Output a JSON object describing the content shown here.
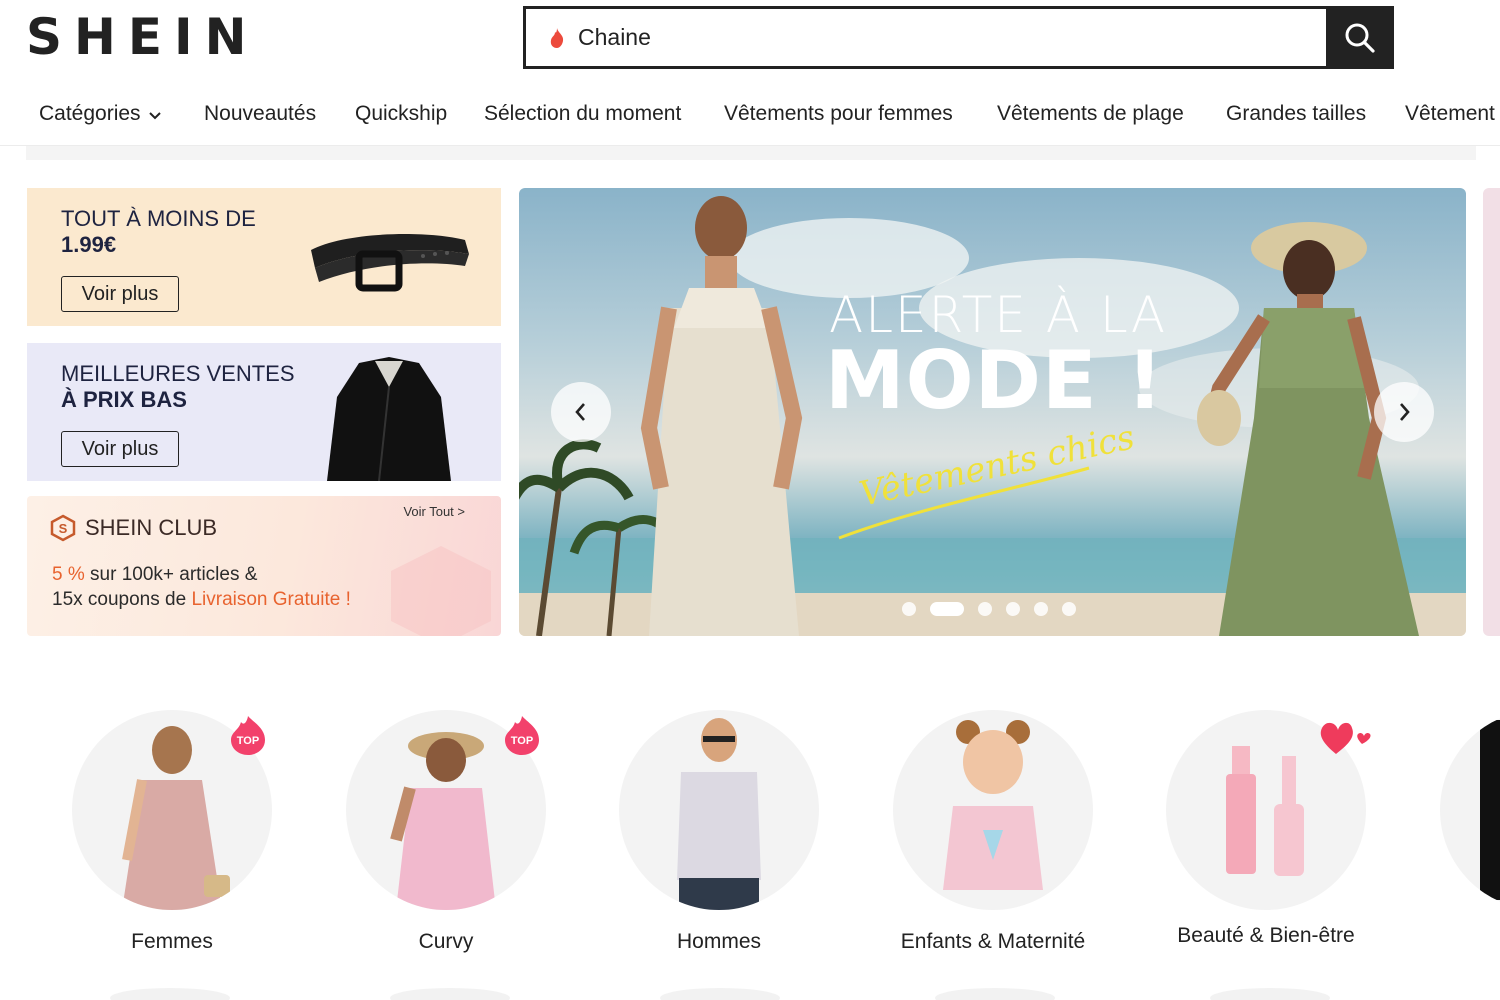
{
  "header": {
    "logo": "SHEIN",
    "search": {
      "query": "Chaine",
      "icon": "flame-icon",
      "button_icon": "search-icon"
    }
  },
  "nav": {
    "items": [
      "Catégories",
      "Nouveautés",
      "Quickship",
      "Sélection du moment",
      "Vêtements pour femmes",
      "Vêtements de plage",
      "Grandes tailles",
      "Vêtement"
    ]
  },
  "promos": {
    "card1": {
      "title_line1": "TOUT À MOINS DE",
      "title_line2": "1.99€",
      "button": "Voir plus",
      "image": "belt"
    },
    "card2": {
      "title_line1": "MEILLEURES VENTES",
      "title_line2": "À PRIX BAS",
      "button": "Voir plus",
      "image": "jacket"
    },
    "club": {
      "name": "SHEIN CLUB",
      "voir_tout": "Voir Tout >",
      "line1_highlight": "5 %",
      "line1_rest": " sur 100k+ articles &",
      "line2_start": "15x coupons de ",
      "line2_highlight": "Livraison Gratuite !"
    }
  },
  "banner": {
    "title_line1": "ALERTE À LA",
    "title_line2": "MODE !",
    "script": "Vêtements chics",
    "slides": 6,
    "active_slide": 2
  },
  "categories": [
    {
      "label": "Femmes",
      "badge": "TOP"
    },
    {
      "label": "Curvy",
      "badge": "TOP"
    },
    {
      "label": "Hommes",
      "badge": ""
    },
    {
      "label": "Enfants & Maternité",
      "badge": ""
    },
    {
      "label": "Beauté & Bien-être",
      "badge": ""
    }
  ],
  "colors": {
    "accent": "#e8632f",
    "badge": "#f2416b",
    "dark": "#222222"
  }
}
